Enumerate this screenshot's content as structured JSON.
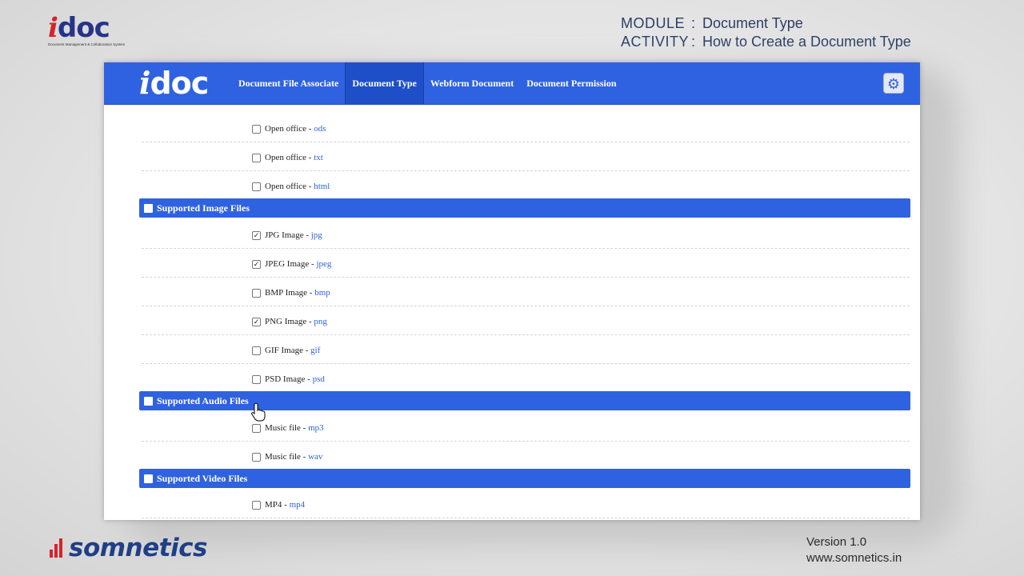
{
  "header": {
    "logo_text_i": "i",
    "logo_text_rest": "doc",
    "logo_tagline": "Document Management & Collaboration System",
    "module_label": "MODULE",
    "module_value": "Document Type",
    "activity_label": "ACTIVITY",
    "activity_value": "How to Create a Document Type"
  },
  "app": {
    "logo_i": "i",
    "logo_rest": "doc",
    "nav": [
      {
        "label": "Document File Associate"
      },
      {
        "label": "Document Type"
      },
      {
        "label": "Webform Document"
      },
      {
        "label": "Document Permission"
      }
    ],
    "settings_icon": "⚙"
  },
  "rows": [
    {
      "label": "Open office - ",
      "ext": "ods",
      "checked": false
    },
    {
      "label": "Open office - ",
      "ext": "txt",
      "checked": false
    },
    {
      "label": "Open office - ",
      "ext": "html",
      "checked": false
    },
    {
      "label": "JPG Image - ",
      "ext": "jpg",
      "checked": true
    },
    {
      "label": "JPEG Image - ",
      "ext": "jpeg",
      "checked": true
    },
    {
      "label": "BMP Image - ",
      "ext": "bmp",
      "checked": false
    },
    {
      "label": "PNG Image - ",
      "ext": "png",
      "checked": true
    },
    {
      "label": "GIF Image - ",
      "ext": "gif",
      "checked": false
    },
    {
      "label": "PSD Image - ",
      "ext": "psd",
      "checked": false
    },
    {
      "label": "Music file - ",
      "ext": "mp3",
      "checked": false
    },
    {
      "label": "Music file - ",
      "ext": "wav",
      "checked": false
    },
    {
      "label": "MP4 - ",
      "ext": "mp4",
      "checked": false
    }
  ],
  "sections": [
    {
      "title": "Supported Image Files"
    },
    {
      "title": "Supported Audio Files"
    },
    {
      "title": "Supported Video Files"
    }
  ],
  "footer": {
    "brand": "somnetics",
    "version": "Version 1.0",
    "website": "www.somnetics.in"
  }
}
